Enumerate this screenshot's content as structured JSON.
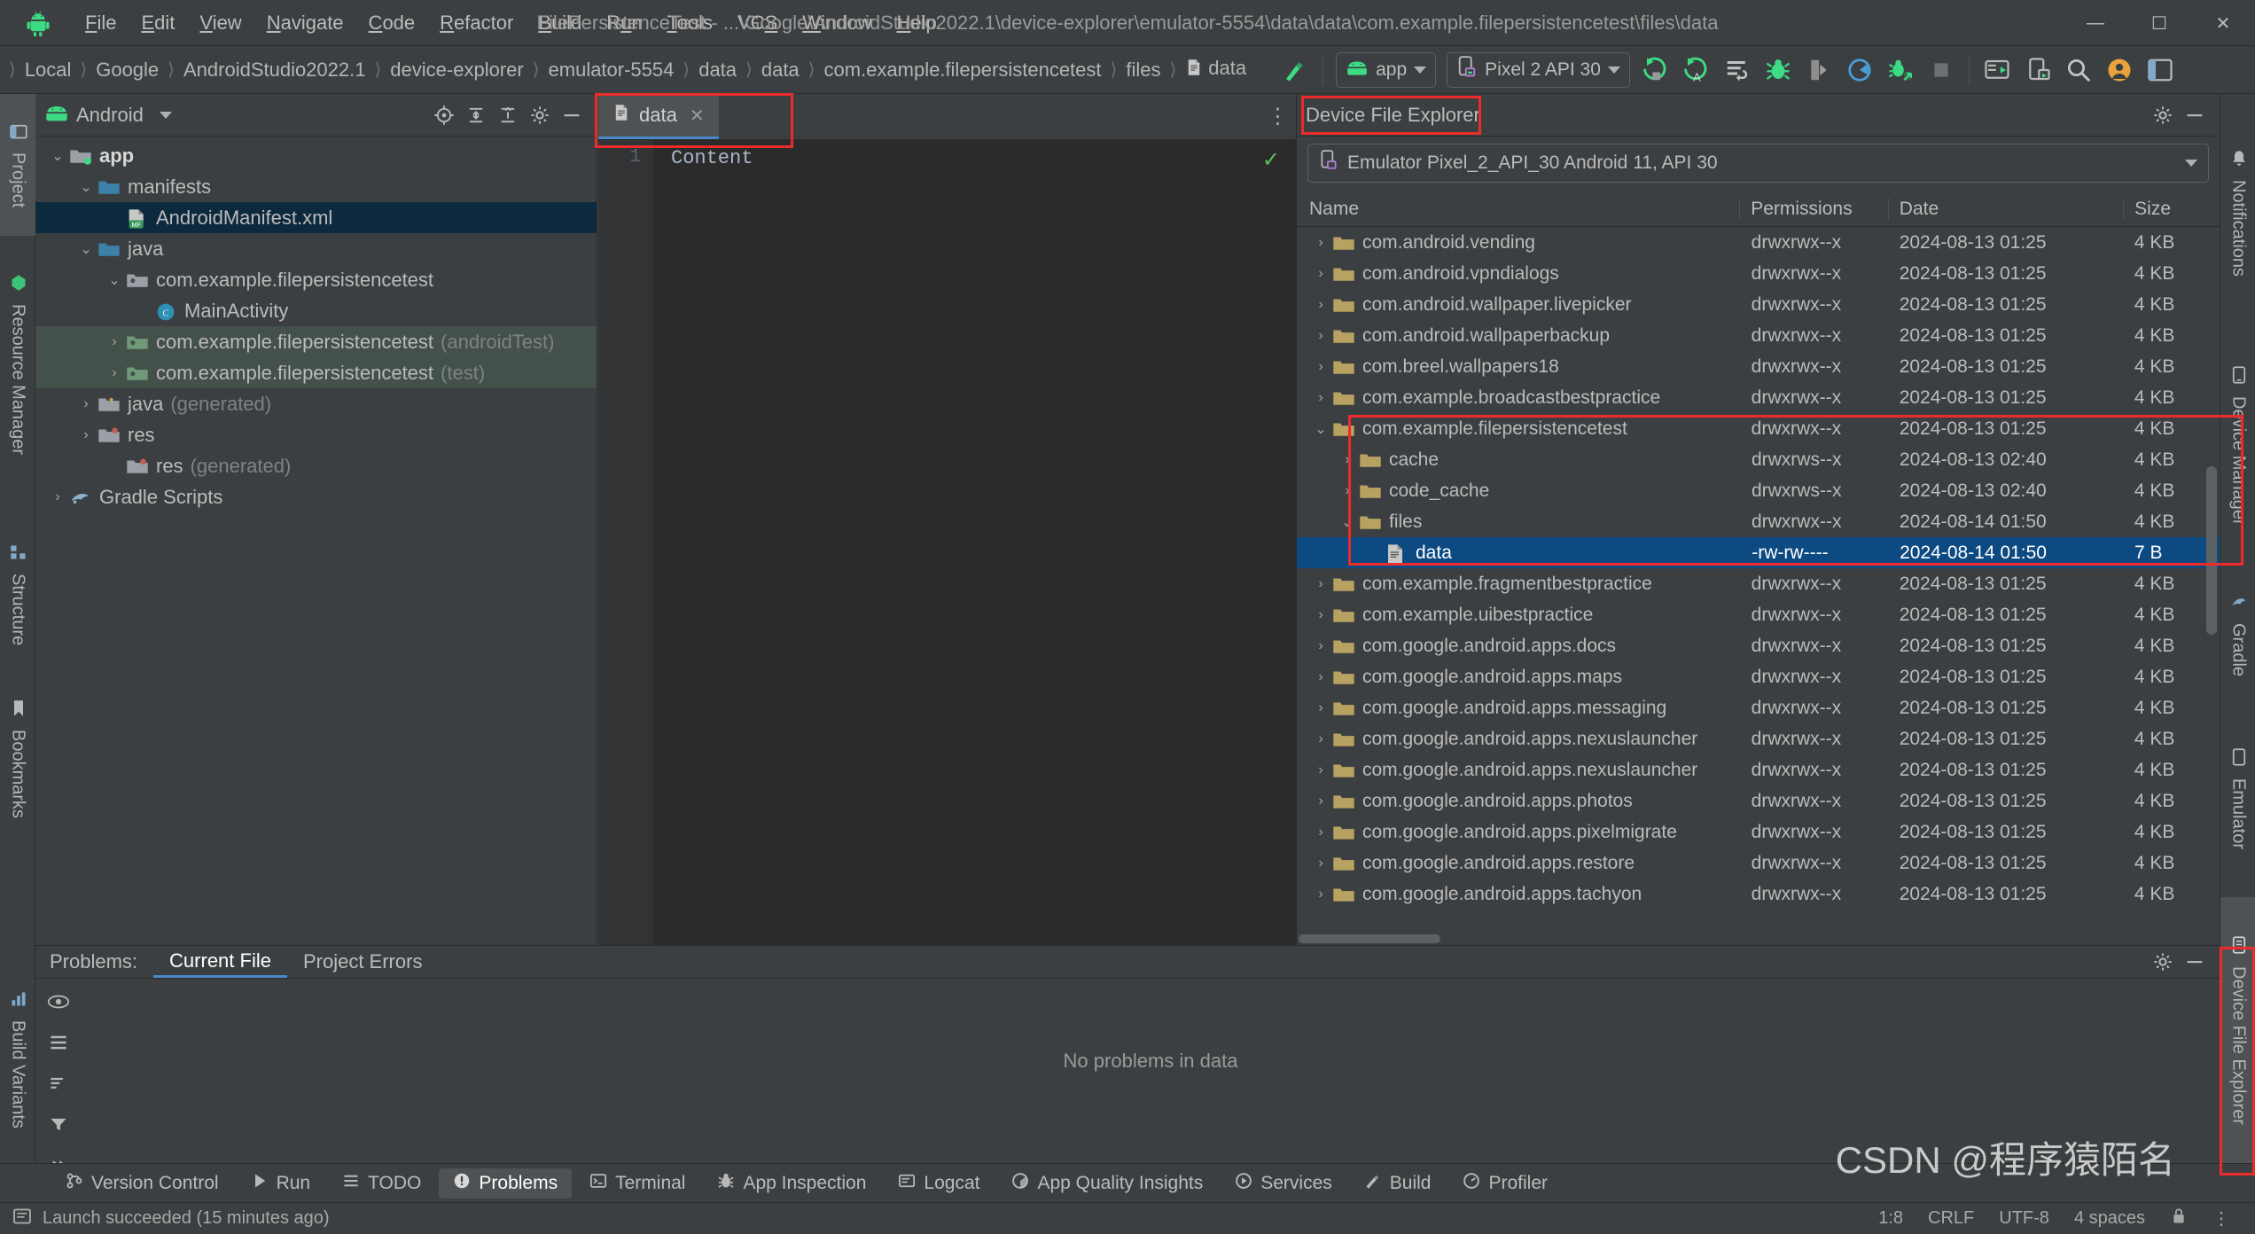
{
  "titlebar": {
    "logo_icon": "android-logo-icon",
    "menus": [
      {
        "label": "File",
        "mnemonic": "F"
      },
      {
        "label": "Edit",
        "mnemonic": "E"
      },
      {
        "label": "View",
        "mnemonic": "V"
      },
      {
        "label": "Navigate",
        "mnemonic": "N"
      },
      {
        "label": "Code",
        "mnemonic": "C"
      },
      {
        "label": "Refactor",
        "mnemonic": "R"
      },
      {
        "label": "Build",
        "mnemonic": "B"
      },
      {
        "label": "Run",
        "mnemonic": "u"
      },
      {
        "label": "Tools",
        "mnemonic": "T"
      },
      {
        "label": "VCS",
        "mnemonic": "S"
      },
      {
        "label": "Window",
        "mnemonic": "W"
      },
      {
        "label": "Help",
        "mnemonic": "H"
      }
    ],
    "title": "FilePersistenceTest - ...\\Google\\AndroidStudio2022.1\\device-explorer\\emulator-5554\\data\\data\\com.example.filepersistencetest\\files\\data",
    "minimize": "—",
    "maximize": "☐",
    "close": "✕"
  },
  "navbar": {
    "breadcrumbs": [
      {
        "label": "Local",
        "icon": ""
      },
      {
        "label": "Google",
        "icon": ""
      },
      {
        "label": "AndroidStudio2022.1",
        "icon": ""
      },
      {
        "label": "device-explorer",
        "icon": ""
      },
      {
        "label": "emulator-5554",
        "icon": ""
      },
      {
        "label": "data",
        "icon": ""
      },
      {
        "label": "data",
        "icon": ""
      },
      {
        "label": "com.example.filepersistencetest",
        "icon": ""
      },
      {
        "label": "files",
        "icon": ""
      },
      {
        "label": "data",
        "icon": "file-icon"
      }
    ],
    "separator": "〉",
    "build_icon": "hammer-icon",
    "run_config": {
      "label": "app",
      "icon": "android-head-icon"
    },
    "device": {
      "label": "Pixel 2 API 30",
      "icon": "device-icon"
    },
    "actions": [
      {
        "name": "run-button",
        "icon": "run-icon"
      },
      {
        "name": "run-with-coverage-button",
        "icon": "run-coverage-icon"
      },
      {
        "name": "apply-changes-button",
        "icon": "apply-changes-icon"
      },
      {
        "name": "debug-button",
        "icon": "debug-icon"
      },
      {
        "name": "attach-debugger-button",
        "icon": "attach-debugger-icon"
      },
      {
        "name": "profiler-button",
        "icon": "profiler-icon"
      },
      {
        "name": "device-manager-button",
        "icon": "device-manager-icon"
      },
      {
        "name": "stop-button",
        "icon": "stop-icon"
      },
      {
        "name": "sdk-manager-button",
        "icon": "sdk-manager-icon"
      },
      {
        "name": "avd-manager-button",
        "icon": "avd-manager-icon"
      },
      {
        "name": "search-button",
        "icon": "search-icon"
      },
      {
        "name": "account-button",
        "icon": "account-icon"
      },
      {
        "name": "layout-button",
        "icon": "layout-icon"
      }
    ]
  },
  "left_stripe": [
    {
      "label": "Project",
      "icon": "project-icon",
      "active": true
    },
    {
      "label": "Resource Manager",
      "icon": "resource-icon",
      "active": false
    },
    {
      "label": "Structure",
      "icon": "structure-icon",
      "active": false
    },
    {
      "label": "Bookmarks",
      "icon": "bookmarks-icon",
      "active": false
    },
    {
      "label": "Build Variants",
      "icon": "build-variants-icon",
      "active": false
    }
  ],
  "right_stripe": [
    {
      "label": "Notifications",
      "icon": "notifications-icon"
    },
    {
      "label": "Device Manager",
      "icon": "device-manager-icon"
    },
    {
      "label": "Gradle",
      "icon": "gradle-icon"
    },
    {
      "label": "Emulator",
      "icon": "emulator-icon"
    },
    {
      "label": "Device File Explorer",
      "icon": "device-file-explorer-icon"
    }
  ],
  "project_panel": {
    "title": "Android",
    "title_icon": "android-head-icon",
    "header_buttons": [
      {
        "name": "select-opened-file-button",
        "icon": "target-icon"
      },
      {
        "name": "expand-all-button",
        "icon": "expand-all-icon"
      },
      {
        "name": "collapse-all-button",
        "icon": "collapse-all-icon"
      },
      {
        "name": "settings-button",
        "icon": "gear-icon"
      },
      {
        "name": "hide-button",
        "icon": "minimize-icon"
      }
    ],
    "tree": [
      {
        "indent": 0,
        "arrow": "down",
        "icon": "module-icon",
        "label": "app",
        "bold": true,
        "suffix": "",
        "state": "normal"
      },
      {
        "indent": 1,
        "arrow": "down",
        "icon": "folder-blue-icon",
        "label": "manifests",
        "bold": false,
        "suffix": "",
        "state": "normal"
      },
      {
        "indent": 2,
        "arrow": "none",
        "icon": "manifest-file-icon",
        "label": "AndroidManifest.xml",
        "bold": false,
        "suffix": "",
        "state": "selected"
      },
      {
        "indent": 1,
        "arrow": "down",
        "icon": "folder-blue-icon",
        "label": "java",
        "bold": false,
        "suffix": "",
        "state": "normal"
      },
      {
        "indent": 2,
        "arrow": "down",
        "icon": "package-icon",
        "label": "com.example.filepersistencetest",
        "bold": false,
        "suffix": "",
        "state": "normal"
      },
      {
        "indent": 3,
        "arrow": "none",
        "icon": "class-icon",
        "label": "MainActivity",
        "bold": false,
        "suffix": "",
        "state": "normal"
      },
      {
        "indent": 2,
        "arrow": "right",
        "icon": "package-icon",
        "label": "com.example.filepersistencetest",
        "bold": false,
        "suffix": "(androidTest)",
        "state": "green"
      },
      {
        "indent": 2,
        "arrow": "right",
        "icon": "package-icon",
        "label": "com.example.filepersistencetest",
        "bold": false,
        "suffix": "(test)",
        "state": "green"
      },
      {
        "indent": 1,
        "arrow": "right",
        "icon": "folder-generated-icon",
        "label": "java",
        "bold": false,
        "suffix": "(generated)",
        "state": "normal"
      },
      {
        "indent": 1,
        "arrow": "right",
        "icon": "folder-res-icon",
        "label": "res",
        "bold": false,
        "suffix": "",
        "state": "normal"
      },
      {
        "indent": 1,
        "arrow": "none",
        "icon": "folder-res-icon",
        "label": "res",
        "bold": false,
        "suffix": "(generated)",
        "state": "normal"
      },
      {
        "indent": 0,
        "arrow": "right",
        "icon": "gradle-icon",
        "label": "Gradle Scripts",
        "bold": false,
        "suffix": "",
        "state": "normal"
      }
    ]
  },
  "editor": {
    "tab": {
      "label": "data",
      "icon": "file-icon",
      "close": "✕"
    },
    "kebab": "⋮",
    "gutter_lines": [
      "1"
    ],
    "content_lines": [
      "Content"
    ],
    "inspection_ok_icon": "checkmark-icon"
  },
  "device_file_explorer": {
    "title": "Device File Explorer",
    "header_buttons": [
      {
        "name": "settings-button",
        "icon": "gear-icon"
      },
      {
        "name": "hide-button",
        "icon": "minimize-icon"
      }
    ],
    "device_selector": {
      "label": "Emulator Pixel_2_API_30 Android 11, API 30",
      "icon": "device-icon"
    },
    "columns": [
      "Name",
      "Permissions",
      "Date",
      "Size"
    ],
    "rows": [
      {
        "arrow": "right",
        "indent": 0,
        "icon": "folder-icon",
        "name": "com.android.vending",
        "permissions": "drwxrwx--x",
        "date": "2024-08-13 01:25",
        "size": "4 KB",
        "state": "normal"
      },
      {
        "arrow": "right",
        "indent": 0,
        "icon": "folder-icon",
        "name": "com.android.vpndialogs",
        "permissions": "drwxrwx--x",
        "date": "2024-08-13 01:25",
        "size": "4 KB",
        "state": "normal"
      },
      {
        "arrow": "right",
        "indent": 0,
        "icon": "folder-icon",
        "name": "com.android.wallpaper.livepicker",
        "permissions": "drwxrwx--x",
        "date": "2024-08-13 01:25",
        "size": "4 KB",
        "state": "normal"
      },
      {
        "arrow": "right",
        "indent": 0,
        "icon": "folder-icon",
        "name": "com.android.wallpaperbackup",
        "permissions": "drwxrwx--x",
        "date": "2024-08-13 01:25",
        "size": "4 KB",
        "state": "normal"
      },
      {
        "arrow": "right",
        "indent": 0,
        "icon": "folder-icon",
        "name": "com.breel.wallpapers18",
        "permissions": "drwxrwx--x",
        "date": "2024-08-13 01:25",
        "size": "4 KB",
        "state": "normal"
      },
      {
        "arrow": "right",
        "indent": 0,
        "icon": "folder-icon",
        "name": "com.example.broadcastbestpractice",
        "permissions": "drwxrwx--x",
        "date": "2024-08-13 01:25",
        "size": "4 KB",
        "state": "normal"
      },
      {
        "arrow": "down",
        "indent": 0,
        "icon": "folder-icon",
        "name": "com.example.filepersistencetest",
        "permissions": "drwxrwx--x",
        "date": "2024-08-13 01:25",
        "size": "4 KB",
        "state": "normal"
      },
      {
        "arrow": "right",
        "indent": 1,
        "icon": "folder-icon",
        "name": "cache",
        "permissions": "drwxrws--x",
        "date": "2024-08-13 02:40",
        "size": "4 KB",
        "state": "normal"
      },
      {
        "arrow": "right",
        "indent": 1,
        "icon": "folder-icon",
        "name": "code_cache",
        "permissions": "drwxrws--x",
        "date": "2024-08-13 02:40",
        "size": "4 KB",
        "state": "normal"
      },
      {
        "arrow": "down",
        "indent": 1,
        "icon": "folder-icon",
        "name": "files",
        "permissions": "drwxrwx--x",
        "date": "2024-08-14 01:50",
        "size": "4 KB",
        "state": "normal"
      },
      {
        "arrow": "none",
        "indent": 2,
        "icon": "file-icon",
        "name": "data",
        "permissions": "-rw-rw----",
        "date": "2024-08-14 01:50",
        "size": "7 B",
        "state": "selected"
      },
      {
        "arrow": "right",
        "indent": 0,
        "icon": "folder-icon",
        "name": "com.example.fragmentbestpractice",
        "permissions": "drwxrwx--x",
        "date": "2024-08-13 01:25",
        "size": "4 KB",
        "state": "normal"
      },
      {
        "arrow": "right",
        "indent": 0,
        "icon": "folder-icon",
        "name": "com.example.uibestpractice",
        "permissions": "drwxrwx--x",
        "date": "2024-08-13 01:25",
        "size": "4 KB",
        "state": "normal"
      },
      {
        "arrow": "right",
        "indent": 0,
        "icon": "folder-icon",
        "name": "com.google.android.apps.docs",
        "permissions": "drwxrwx--x",
        "date": "2024-08-13 01:25",
        "size": "4 KB",
        "state": "normal"
      },
      {
        "arrow": "right",
        "indent": 0,
        "icon": "folder-icon",
        "name": "com.google.android.apps.maps",
        "permissions": "drwxrwx--x",
        "date": "2024-08-13 01:25",
        "size": "4 KB",
        "state": "normal"
      },
      {
        "arrow": "right",
        "indent": 0,
        "icon": "folder-icon",
        "name": "com.google.android.apps.messaging",
        "permissions": "drwxrwx--x",
        "date": "2024-08-13 01:25",
        "size": "4 KB",
        "state": "normal"
      },
      {
        "arrow": "right",
        "indent": 0,
        "icon": "folder-icon",
        "name": "com.google.android.apps.nexuslauncher",
        "permissions": "drwxrwx--x",
        "date": "2024-08-13 01:25",
        "size": "4 KB",
        "state": "normal"
      },
      {
        "arrow": "right",
        "indent": 0,
        "icon": "folder-icon",
        "name": "com.google.android.apps.nexuslauncher",
        "permissions": "drwxrwx--x",
        "date": "2024-08-13 01:25",
        "size": "4 KB",
        "state": "normal"
      },
      {
        "arrow": "right",
        "indent": 0,
        "icon": "folder-icon",
        "name": "com.google.android.apps.photos",
        "permissions": "drwxrwx--x",
        "date": "2024-08-13 01:25",
        "size": "4 KB",
        "state": "normal"
      },
      {
        "arrow": "right",
        "indent": 0,
        "icon": "folder-icon",
        "name": "com.google.android.apps.pixelmigrate",
        "permissions": "drwxrwx--x",
        "date": "2024-08-13 01:25",
        "size": "4 KB",
        "state": "normal"
      },
      {
        "arrow": "right",
        "indent": 0,
        "icon": "folder-icon",
        "name": "com.google.android.apps.restore",
        "permissions": "drwxrwx--x",
        "date": "2024-08-13 01:25",
        "size": "4 KB",
        "state": "normal"
      },
      {
        "arrow": "right",
        "indent": 0,
        "icon": "folder-icon",
        "name": "com.google.android.apps.tachyon",
        "permissions": "drwxrwx--x",
        "date": "2024-08-13 01:25",
        "size": "4 KB",
        "state": "normal"
      }
    ]
  },
  "problems_panel": {
    "label": "Problems:",
    "tabs": [
      {
        "label": "Current File",
        "active": true
      },
      {
        "label": "Project Errors",
        "active": false
      }
    ],
    "buttons": [
      {
        "name": "preview-button",
        "icon": "eye-icon"
      },
      {
        "name": "group-button",
        "icon": "group-icon"
      },
      {
        "name": "sort-button",
        "icon": "sort-icon"
      },
      {
        "name": "filter-button",
        "icon": "filter-icon"
      },
      {
        "name": "expand-more-button",
        "icon": "chevron-double-icon"
      }
    ],
    "empty_message": "No problems in data",
    "settings_icon": "gear-icon",
    "hide_icon": "minimize-icon"
  },
  "bottom_tabs": [
    {
      "label": "Version Control",
      "icon": "version-control-icon",
      "active": false
    },
    {
      "label": "Run",
      "icon": "run-icon",
      "active": false
    },
    {
      "label": "TODO",
      "icon": "todo-icon",
      "active": false
    },
    {
      "label": "Problems",
      "icon": "problems-icon",
      "active": true
    },
    {
      "label": "Terminal",
      "icon": "terminal-icon",
      "active": false
    },
    {
      "label": "App Inspection",
      "icon": "app-inspection-icon",
      "active": false
    },
    {
      "label": "Logcat",
      "icon": "logcat-icon",
      "active": false
    },
    {
      "label": "App Quality Insights",
      "icon": "quality-insights-icon",
      "active": false
    },
    {
      "label": "Services",
      "icon": "services-icon",
      "active": false
    },
    {
      "label": "Build",
      "icon": "build-icon",
      "active": false
    },
    {
      "label": "Profiler",
      "icon": "profiler-icon",
      "active": false
    }
  ],
  "statusbar": {
    "left_icon": "event-log-icon",
    "message": "Launch succeeded (15 minutes ago)",
    "caret": "1:8",
    "line_separator": "CRLF",
    "encoding": "UTF-8",
    "indent": "4 spaces",
    "lock_icon": "lock-icon",
    "kebab": "⋮"
  },
  "watermark": "CSDN @程序猿陌名",
  "colors": {
    "accent_blue": "#4a88c7",
    "selection_blue": "#0d4a82",
    "tree_selection": "#0d293e",
    "annotation_red": "#ee2b2b",
    "android_green": "#3ddc84",
    "panel_bg": "#3c3f41",
    "editor_bg": "#2b2b2b"
  }
}
